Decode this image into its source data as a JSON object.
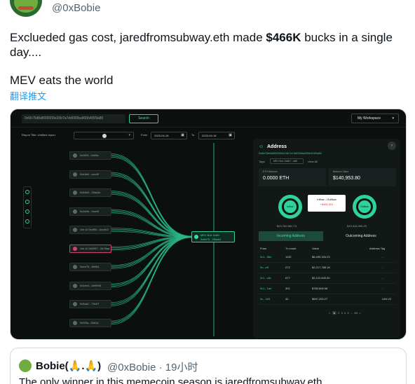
{
  "author": {
    "handle": "@0xBobie"
  },
  "tweet": {
    "text_before": "Exclueded gas cost, jaredfromsubway.eth made ",
    "amount": "$466K",
    "text_after": " bucks in a single day....",
    "line2": "MEV eats the world",
    "translate": "翻译推文"
  },
  "screenshot": {
    "address_input": "0x6b75d8af000000e20b7a7dd000ba900b4009a80",
    "search_label": "Search",
    "workspace_label": "My Workspace",
    "report_title_label": "Report Title: Untitled report",
    "from_label": "From",
    "from_date": "2023-04-18",
    "to_label": "To",
    "to_date": "2023-04-18",
    "left_nodes": [
      "0x0f23...0d49a",
      "0xe4d0...cccd9",
      "0x54e0...25ac5c",
      "0x2e0b...0ccb9",
      "Uni v3 0x4f5b...6cc4b2",
      "Uni v2 0x0267...3a78aa",
      "0xee75...9b081",
      "0x1ee4...0b9998",
      "0x5da7...79c07",
      "0x02fa...2bd1a"
    ],
    "center_node": "MEV Bot: 0x6b\n0x6b75...2f0a48",
    "panel": {
      "title": "Address",
      "address": "0x6b75d8af000000e20b7a7dd000ba900b4009a80",
      "tags_label": "Tags:",
      "tag": "MEV Bot: 0x6b7...a80",
      "view_all": "View All",
      "eth_balance_label": "ETH Balance",
      "eth_balance": "0.0000 ETH",
      "balance_value_label": "Balance Value",
      "balance_value": "$140,953.80",
      "inflow_label": "Inflow",
      "outflow_label": "Outflow",
      "net_label": "Inflow - Outflow",
      "net_value": "+$466,091",
      "inflow_value": "$19,782,581.74",
      "outflow_value": "$19,316,490.25",
      "tab_incoming": "Incoming Address",
      "tab_outgoing": "Outcoming Address",
      "columns": [
        "From",
        "Tx count",
        "Value",
        "Address Tag"
      ],
      "rows": [
        {
          "from": "0x1...36e",
          "tx": "1132",
          "value": "$8,499,325.23",
          "tag": "-"
        },
        {
          "from": "0x...eff",
          "tx": "272",
          "value": "$2,217,788.18",
          "tag": "-"
        },
        {
          "from": "0x1...c8c",
          "tx": "677",
          "value": "$2,122,843.50",
          "tag": "-"
        },
        {
          "from": "0x1...1ab",
          "tx": "301",
          "value": "$780,606.98",
          "tag": "-"
        },
        {
          "from": "0x...3b5",
          "tx": "42",
          "value": "$657,200.27",
          "tag": "UNI-V2"
        }
      ],
      "pager": [
        "<",
        "1",
        "2",
        "3",
        "4",
        "5",
        "...",
        "60",
        ">"
      ]
    }
  },
  "quote": {
    "name": "Bobie(🙏.🙏)",
    "meta": "@0xBobie · 19小时",
    "text": "The only winner in this memecoin season is jaredfromsubway.eth"
  }
}
